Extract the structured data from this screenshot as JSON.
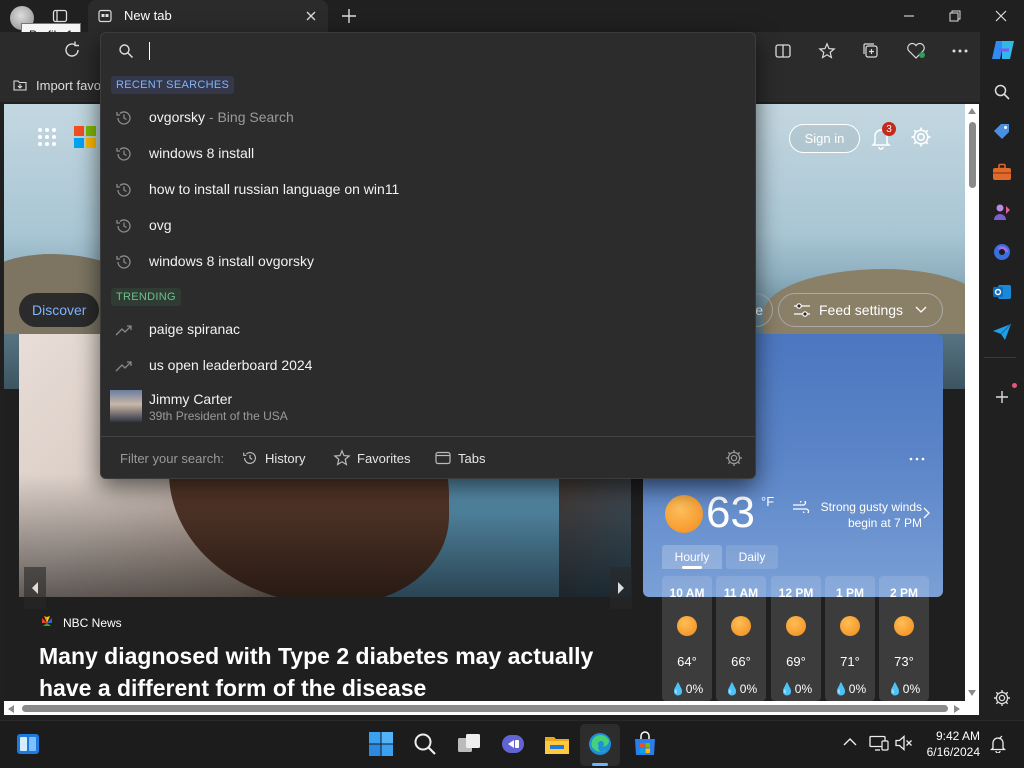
{
  "browser": {
    "tab_title": "New tab",
    "tooltip": "Profile 1",
    "favorites_bar_label": "Import favo"
  },
  "dropdown": {
    "recent_label": "RECENT SEARCHES",
    "recent": [
      {
        "text": "ovgorsky",
        "suffix": " - Bing Search"
      },
      {
        "text": "windows 8 install",
        "suffix": ""
      },
      {
        "text": "how to install russian language on win11",
        "suffix": ""
      },
      {
        "text": "ovg",
        "suffix": ""
      },
      {
        "text": "windows 8 install ovgorsky",
        "suffix": ""
      }
    ],
    "trending_label": "TRENDING",
    "trending": [
      "paige spiranac",
      "us open leaderboard 2024"
    ],
    "entity": {
      "title": "Jimmy Carter",
      "subtitle": "39th President of the USA"
    },
    "filter_label": "Filter your search:",
    "filters": [
      "History",
      "Favorites",
      "Tabs"
    ]
  },
  "page": {
    "signin_label": "Sign in",
    "notification_count": "3",
    "discover_label": "Discover",
    "partial_pill": "e",
    "feed_settings_label": "Feed settings",
    "news": {
      "source": "NBC News",
      "title": "Many diagnosed with Type 2 diabetes may actually have a different form of the disease"
    },
    "weather": {
      "temp": "63",
      "unit": "°F",
      "alert": "Strong gusty winds begin at 7 PM",
      "tabs": [
        "Hourly",
        "Daily"
      ],
      "hours": [
        {
          "time": "10 AM",
          "temp": "64°",
          "rain": "0%"
        },
        {
          "time": "11 AM",
          "temp": "66°",
          "rain": "0%"
        },
        {
          "time": "12 PM",
          "temp": "69°",
          "rain": "0%"
        },
        {
          "time": "1 PM",
          "temp": "71°",
          "rain": "0%"
        },
        {
          "time": "2 PM",
          "temp": "73°",
          "rain": "0%"
        }
      ]
    }
  },
  "taskbar": {
    "time": "9:42 AM",
    "date": "6/16/2024"
  },
  "colors": {
    "accent": "#7fb4ff",
    "trending": "#6cc28d",
    "recent": "#7fb4ff",
    "badge": "#c42b1c"
  }
}
